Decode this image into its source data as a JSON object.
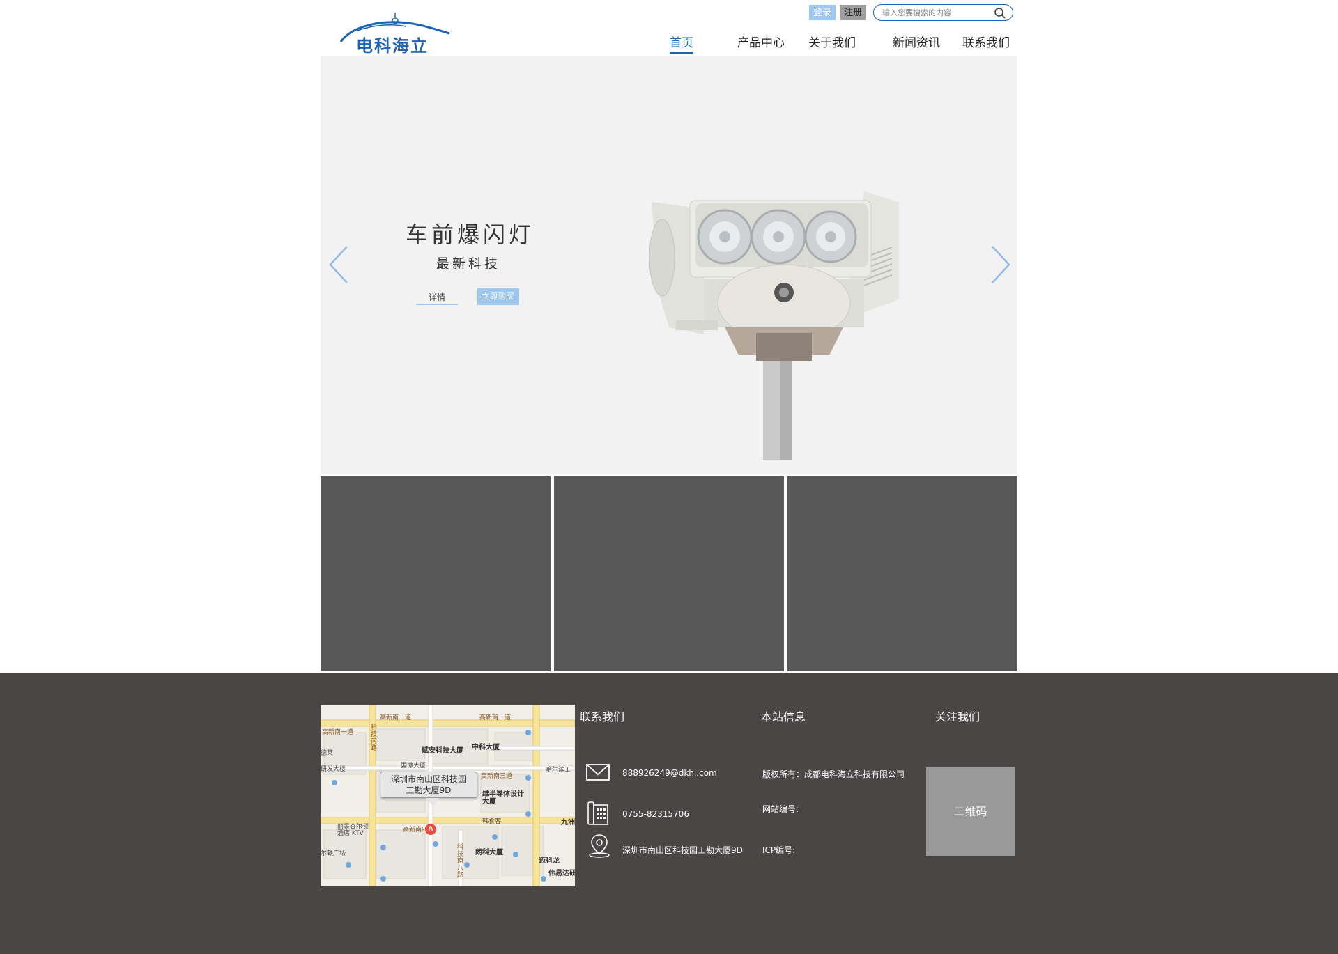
{
  "header": {
    "logo_text": "电科海立",
    "login_label": "登录",
    "register_label": "注册",
    "search_placeholder": "输入您要搜索的内容",
    "nav": [
      {
        "label": "首页",
        "active": true
      },
      {
        "label": "产品中心"
      },
      {
        "label": "关于我们"
      },
      {
        "label": "新闻资讯"
      },
      {
        "label": "联系我们"
      }
    ]
  },
  "banner": {
    "title": "车前爆闪灯",
    "subtitle": "最新科技",
    "detail_label": "详情",
    "buy_label": "立即购买"
  },
  "footer": {
    "map": {
      "label_line1": "深圳市南山区科技园",
      "label_line2": "工勘大厦9D",
      "marker": "A",
      "roads": [
        "高新南一道",
        "高新南一道",
        "高新南三道",
        "高新南四道",
        "高新南一道",
        "科技南路",
        "科技南八路"
      ],
      "buildings": [
        "赋安科技大厦",
        "中科大厦",
        "国微大厦",
        "维半导体设计大厦",
        "丽景查尔顿酒店·KTV",
        "朗科大厦",
        "迈科龙",
        "伟易达研",
        "九洲",
        "韩食客",
        "哈尔滨工",
        "研发大楼",
        "德莱",
        "尔顿广场"
      ]
    },
    "contact": {
      "heading": "联系我们",
      "email": "888926249@dkhl.com",
      "phone": "0755-82315706",
      "address": "深圳市南山区科技园工勘大厦9D"
    },
    "site_info": {
      "heading": "本站信息",
      "copyright": "版权所有：成都电科海立科技有限公司",
      "site_no": "网站编号:",
      "icp": "ICP编号:"
    },
    "follow": {
      "heading": "关注我们",
      "qr_label": "二维码"
    }
  },
  "colors": {
    "brand_blue": "#1d62b4",
    "light_blue": "#9ec8ef",
    "footer_bg": "#4a4646",
    "tile_bg": "#575757",
    "banner_bg": "#f2f2f2"
  }
}
